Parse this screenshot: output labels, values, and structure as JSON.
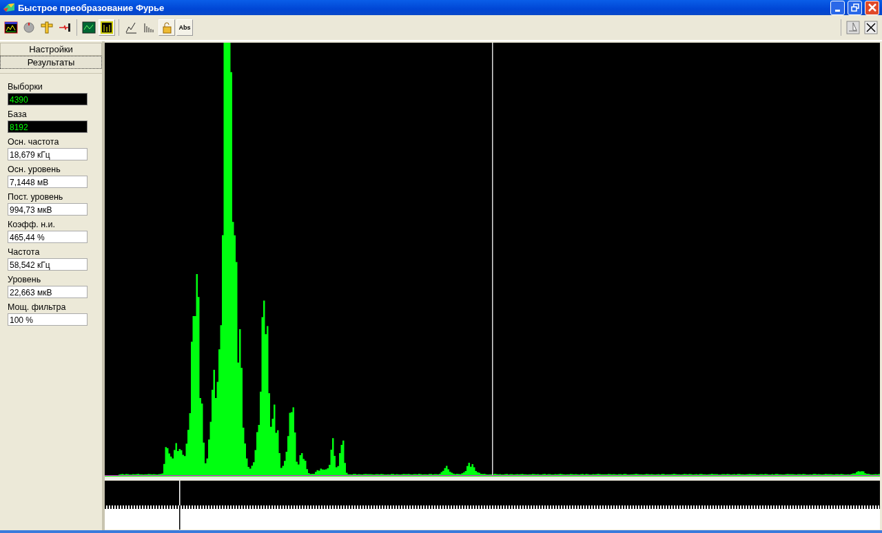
{
  "window": {
    "title": "Быстрое преобразование Фурье"
  },
  "toolbar": [
    {
      "kind": "spectrum",
      "pressed": false
    },
    {
      "kind": "knob",
      "pressed": false
    },
    {
      "kind": "ruler",
      "pressed": false
    },
    {
      "kind": "probe",
      "pressed": false
    },
    {
      "kind": "scope",
      "pressed": false
    },
    {
      "kind": "grid",
      "pressed": true
    },
    {
      "kind": "pen",
      "pressed": false
    },
    {
      "kind": "bars",
      "pressed": false
    },
    {
      "kind": "lock",
      "pressed": true
    },
    {
      "kind": "text",
      "label": "Abs",
      "pressed": true
    }
  ],
  "tabs": [
    {
      "label": "Настройки",
      "selected": false
    },
    {
      "label": "Результаты",
      "selected": true
    }
  ],
  "fields": [
    {
      "label": "Выборки",
      "value": "4390",
      "kind": "counter"
    },
    {
      "label": "База",
      "value": "8192",
      "kind": "counter"
    },
    {
      "label": "Осн. частота",
      "value": "18,679 кГц",
      "kind": "value"
    },
    {
      "label": "Осн. уровень",
      "value": "7,1448 мВ",
      "kind": "value"
    },
    {
      "label": "Пост. уровень",
      "value": "994,73 мкВ",
      "kind": "value"
    },
    {
      "label": "Коэфф. н.и.",
      "value": "465,44 %",
      "kind": "value"
    },
    {
      "label": "Частота",
      "value": "58,542 кГц",
      "kind": "value"
    },
    {
      "label": "Уровень",
      "value": "22,663 мкВ",
      "kind": "value"
    },
    {
      "label": "Мощ. фильтра",
      "value": "100 %",
      "kind": "value"
    }
  ]
}
